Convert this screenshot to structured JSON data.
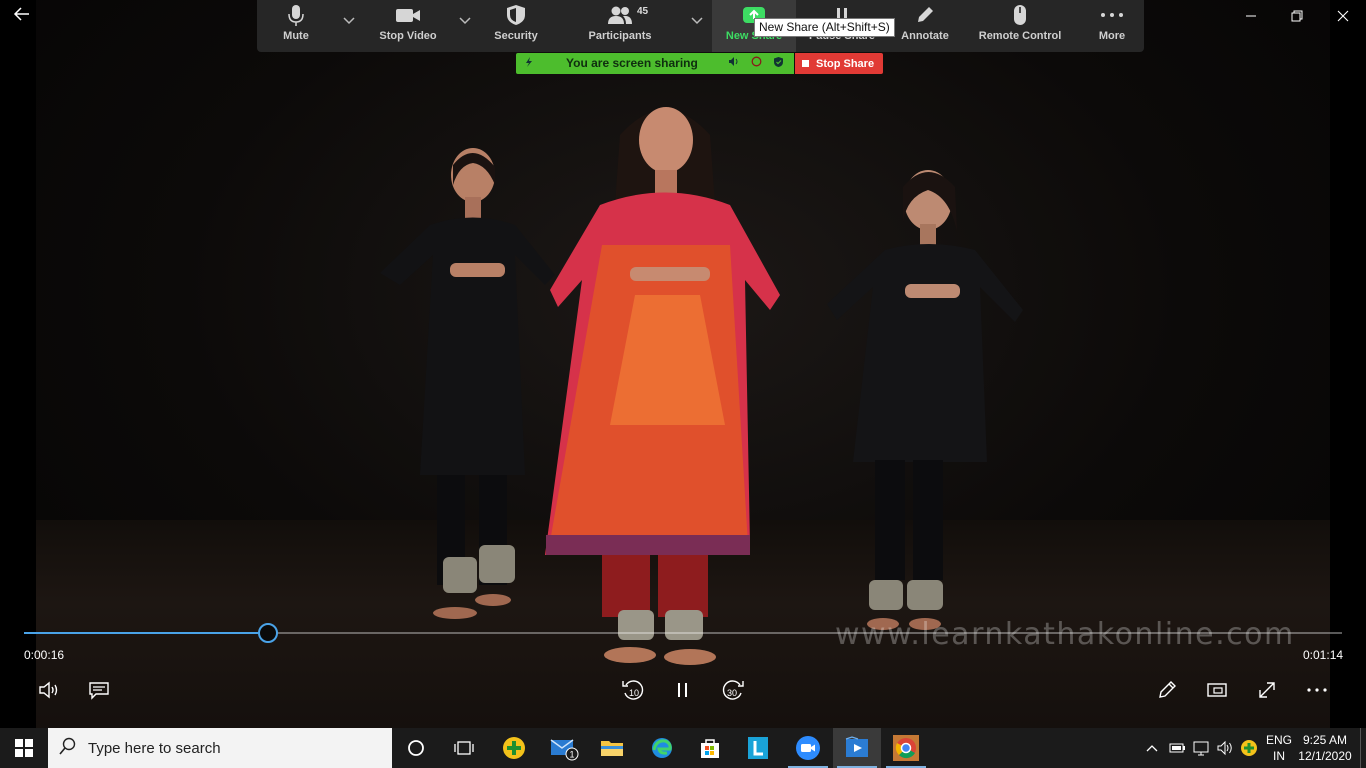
{
  "zoom": {
    "buttons": [
      {
        "label": "Mute",
        "icon": "microphone-icon"
      },
      {
        "label": "Stop Video",
        "icon": "camera-icon"
      },
      {
        "label": "Security",
        "icon": "shield-icon"
      },
      {
        "label": "Participants",
        "icon": "people-icon"
      },
      {
        "label": "New Share",
        "icon": "share-screen-icon"
      },
      {
        "label": "Pause Share",
        "icon": "pause-icon"
      },
      {
        "label": "Annotate",
        "icon": "pencil-icon"
      },
      {
        "label": "Remote Control",
        "icon": "mouse-icon"
      },
      {
        "label": "More",
        "icon": "more-icon"
      }
    ],
    "participants_count": "45",
    "tooltip": "New Share (Alt+Shift+S)",
    "sharing_text": "You are screen sharing",
    "stop_share_label": "Stop Share",
    "active_color": "#3ddc63"
  },
  "video": {
    "watermark": "www.learnkathakonline.com",
    "elapsed": "0:00:16",
    "duration": "0:01:14",
    "progress_fraction": 0.185,
    "accent": "#4aa3e8"
  },
  "taskbar": {
    "search_placeholder": "Type here to search",
    "mail_badge": "1",
    "lang_line1": "ENG",
    "lang_line2": "IN",
    "time": "9:25 AM",
    "date": "12/1/2020"
  }
}
